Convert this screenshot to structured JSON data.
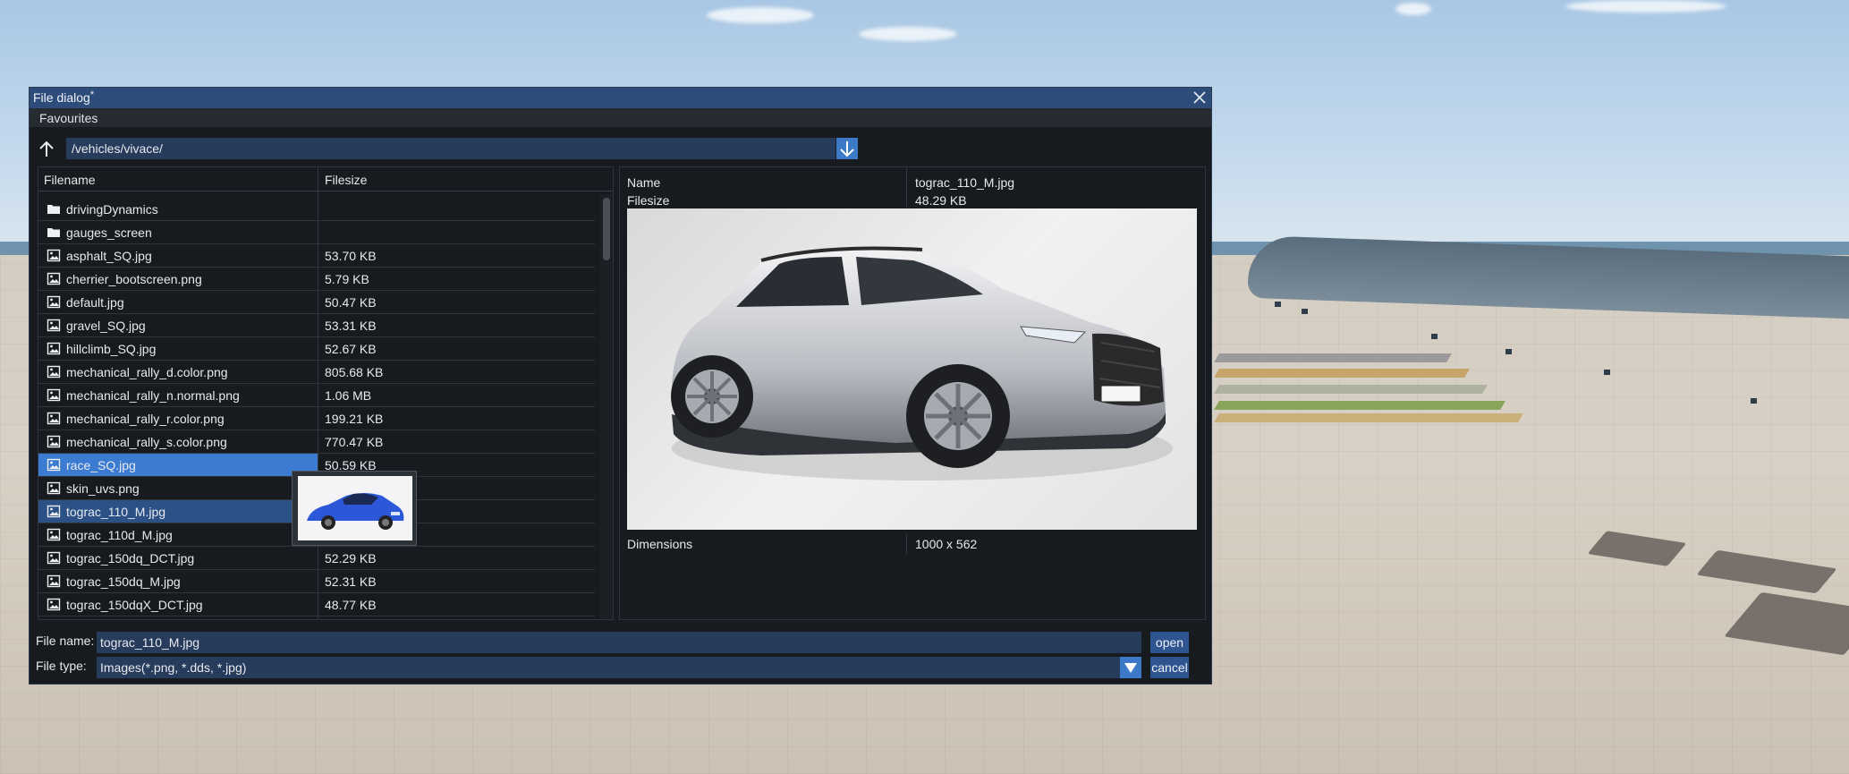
{
  "window": {
    "title": "File dialog",
    "modified_marker": "*"
  },
  "menu": {
    "favourites": "Favourites"
  },
  "path": {
    "value": "/vehicles/vivace/"
  },
  "list": {
    "col_filename": "Filename",
    "col_filesize": "Filesize",
    "rows": [
      {
        "name": "drivingDynamics",
        "size": "",
        "type": "folder"
      },
      {
        "name": "gauges_screen",
        "size": "",
        "type": "folder"
      },
      {
        "name": "asphalt_SQ.jpg",
        "size": "53.70 KB",
        "type": "image"
      },
      {
        "name": "cherrier_bootscreen.png",
        "size": "5.79 KB",
        "type": "image"
      },
      {
        "name": "default.jpg",
        "size": "50.47 KB",
        "type": "image"
      },
      {
        "name": "gravel_SQ.jpg",
        "size": "53.31 KB",
        "type": "image"
      },
      {
        "name": "hillclimb_SQ.jpg",
        "size": "52.67 KB",
        "type": "image"
      },
      {
        "name": "mechanical_rally_d.color.png",
        "size": "805.68 KB",
        "type": "image"
      },
      {
        "name": "mechanical_rally_n.normal.png",
        "size": "1.06 MB",
        "type": "image"
      },
      {
        "name": "mechanical_rally_r.color.png",
        "size": "199.21 KB",
        "type": "image"
      },
      {
        "name": "mechanical_rally_s.color.png",
        "size": "770.47 KB",
        "type": "image"
      },
      {
        "name": "race_SQ.jpg",
        "size": "50.59 KB",
        "type": "image",
        "state": "selected"
      },
      {
        "name": "skin_uvs.png",
        "size": "",
        "type": "image"
      },
      {
        "name": "tograc_110_M.jpg",
        "size": "",
        "type": "image",
        "state": "hover"
      },
      {
        "name": "tograc_110d_M.jpg",
        "size": "",
        "type": "image"
      },
      {
        "name": "tograc_150dq_DCT.jpg",
        "size": "52.29 KB",
        "type": "image"
      },
      {
        "name": "tograc_150dq_M.jpg",
        "size": "52.31 KB",
        "type": "image"
      },
      {
        "name": "tograc_150dqX_DCT.jpg",
        "size": "48.77 KB",
        "type": "image"
      }
    ]
  },
  "preview": {
    "name_label": "Name",
    "name_value": "tograc_110_M.jpg",
    "size_label": "Filesize",
    "size_value": "48.29 KB",
    "dims_label": "Dimensions",
    "dims_value": "1000 x 562"
  },
  "bottom": {
    "filename_label": "File name:",
    "filename_value": "tograc_110_M.jpg",
    "filetype_label": "File type:",
    "filetype_value": "Images(*.png, *.dds, *.jpg)",
    "open_label": "open",
    "cancel_label": "cancel"
  },
  "colors": {
    "title_bar": "#2e4c7a",
    "selection": "#3b7bd2",
    "hover": "#2b5187",
    "input_bg": "#273b5c",
    "accent_button": "#3c79c6"
  },
  "icons": {
    "close": "close-icon",
    "up": "arrow-up-icon",
    "go": "arrow-down-icon",
    "folder": "folder-icon",
    "image": "image-file-icon",
    "dropdown": "triangle-down-icon"
  }
}
